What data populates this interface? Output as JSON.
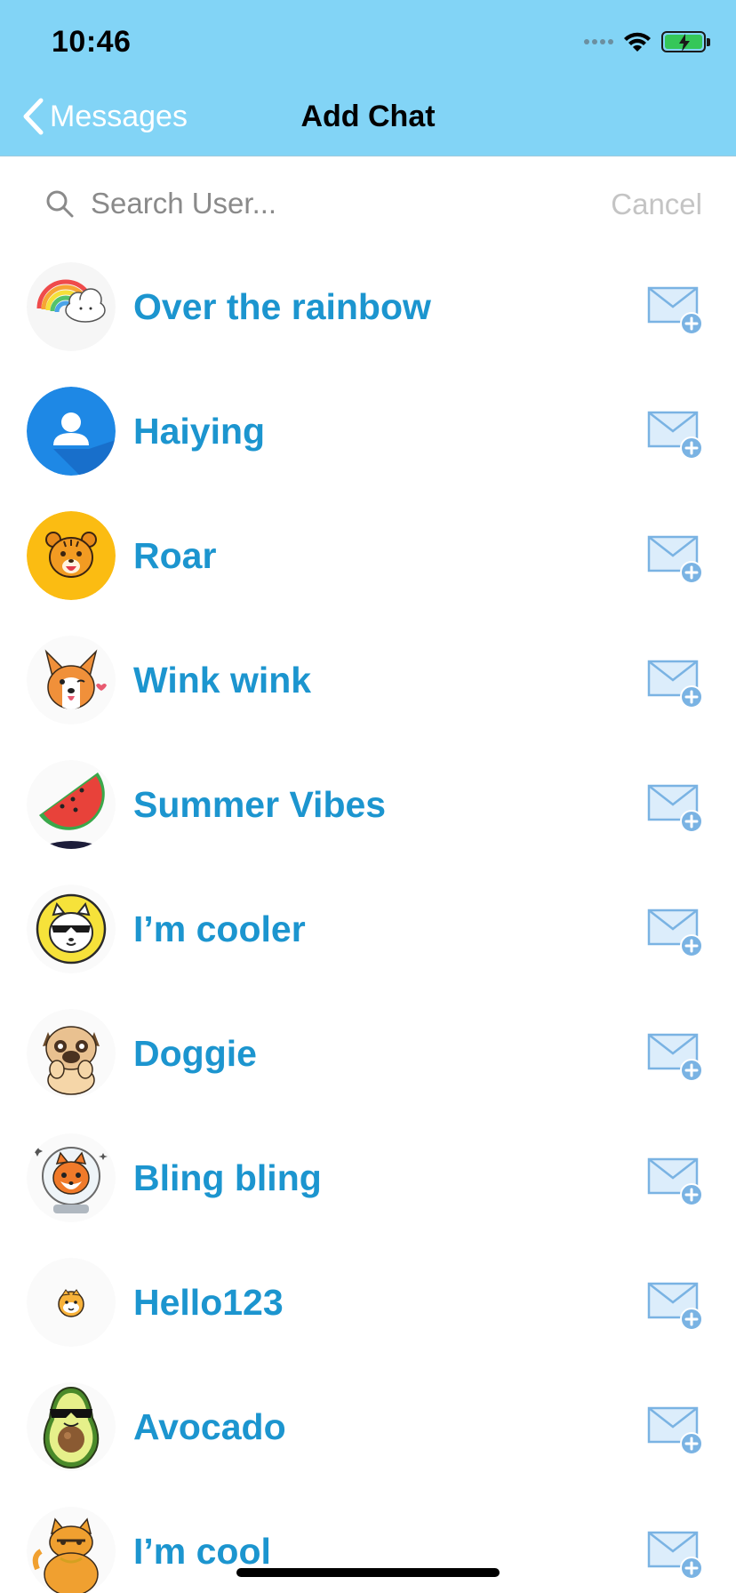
{
  "status": {
    "time": "10:46"
  },
  "nav": {
    "back_label": "Messages",
    "title": "Add Chat"
  },
  "search": {
    "placeholder": "Search User...",
    "cancel_label": "Cancel"
  },
  "colors": {
    "header_bg": "#82d4f6",
    "name_blue": "#1c95cf",
    "mail_fill": "#dcedfb",
    "mail_stroke": "#7ab3e3"
  },
  "users": [
    {
      "name": "Over the rainbow",
      "avatar": "rainbow-cloud-avatar"
    },
    {
      "name": "Haiying",
      "avatar": "person-silhouette-avatar"
    },
    {
      "name": "Roar",
      "avatar": "tiger-avatar"
    },
    {
      "name": "Wink wink",
      "avatar": "corgi-avatar"
    },
    {
      "name": "Summer Vibes",
      "avatar": "watermelon-avatar"
    },
    {
      "name": "I’m cooler",
      "avatar": "cool-cat-sunglasses-avatar"
    },
    {
      "name": "Doggie",
      "avatar": "pug-avatar"
    },
    {
      "name": "Bling bling",
      "avatar": "space-fox-avatar"
    },
    {
      "name": "Hello123",
      "avatar": "small-face-avatar"
    },
    {
      "name": "Avocado",
      "avatar": "avocado-avatar"
    },
    {
      "name": "I’m cool",
      "avatar": "orange-cat-avatar"
    }
  ]
}
